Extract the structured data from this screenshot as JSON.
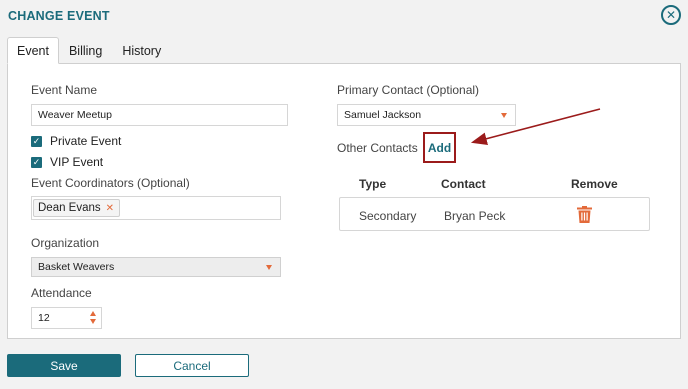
{
  "dialog": {
    "title": "CHANGE EVENT"
  },
  "tabs": [
    {
      "label": "Event",
      "active": true
    },
    {
      "label": "Billing",
      "active": false
    },
    {
      "label": "History",
      "active": false
    }
  ],
  "form": {
    "event_name_label": "Event Name",
    "event_name_value": "Weaver Meetup",
    "private_event_label": "Private Event",
    "private_event_checked": true,
    "vip_event_label": "VIP Event",
    "vip_event_checked": true,
    "coordinators_label": "Event Coordinators (Optional)",
    "coordinators": [
      "Dean Evans"
    ],
    "organization_label": "Organization",
    "organization_value": "Basket Weavers",
    "attendance_label": "Attendance",
    "attendance_value": "12",
    "primary_contact_label": "Primary Contact (Optional)",
    "primary_contact_value": "Samuel Jackson",
    "other_contacts_label": "Other Contacts",
    "add_label": "Add"
  },
  "contacts_table": {
    "headers": {
      "type": "Type",
      "contact": "Contact",
      "remove": "Remove"
    },
    "rows": [
      {
        "type": "Secondary",
        "contact": "Bryan Peck"
      }
    ]
  },
  "buttons": {
    "save": "Save",
    "cancel": "Cancel"
  },
  "icons": {
    "close": "close-circle-icon",
    "remove": "trash-icon",
    "tag_remove": "x-icon"
  },
  "colors": {
    "accent": "#1b6b7b",
    "warning": "#e36a3a",
    "annotation": "#9b1b1b"
  }
}
